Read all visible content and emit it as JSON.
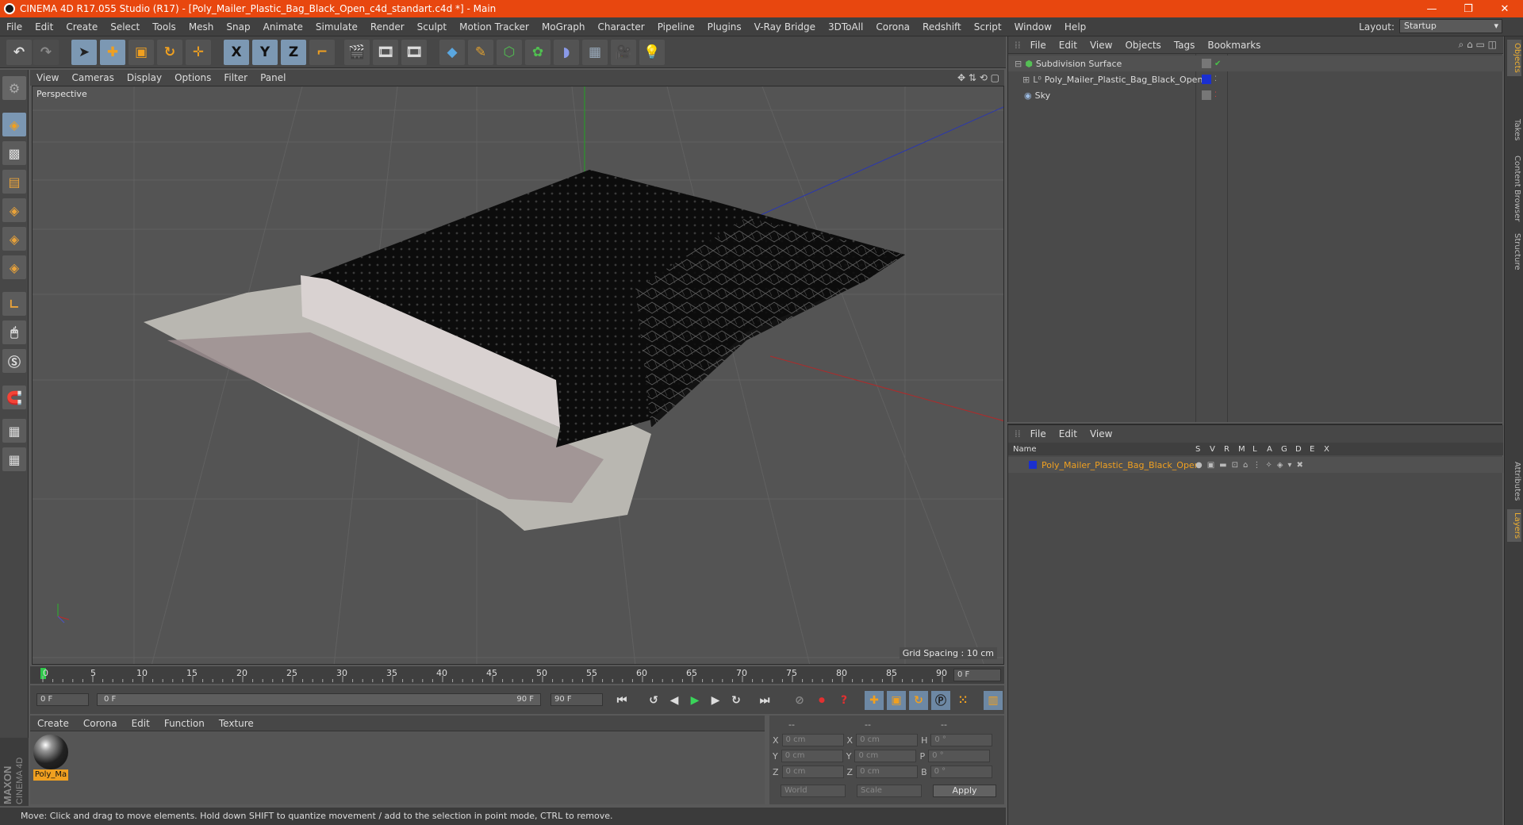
{
  "window": {
    "title": "CINEMA 4D R17.055 Studio (R17) - [Poly_Mailer_Plastic_Bag_Black_Open_c4d_standart.c4d *] - Main",
    "minimize": "—",
    "restore": "❐",
    "close": "✕"
  },
  "menu": [
    "File",
    "Edit",
    "Create",
    "Select",
    "Tools",
    "Mesh",
    "Snap",
    "Animate",
    "Simulate",
    "Render",
    "Sculpt",
    "Motion Tracker",
    "MoGraph",
    "Character",
    "Pipeline",
    "Plugins",
    "V-Ray Bridge",
    "3DToAll",
    "Corona",
    "Redshift",
    "Script",
    "Window",
    "Help"
  ],
  "layout": {
    "label": "Layout:",
    "value": "Startup"
  },
  "toolbar": {
    "x_axis": "X",
    "y_axis": "Y",
    "z_axis": "Z"
  },
  "viewport": {
    "menu": [
      "View",
      "Cameras",
      "Display",
      "Options",
      "Filter",
      "Panel"
    ],
    "name": "Perspective",
    "grid_spacing": "Grid Spacing : 10 cm"
  },
  "timeline": {
    "ticks": [
      "0",
      "5",
      "10",
      "15",
      "20",
      "25",
      "30",
      "35",
      "40",
      "45",
      "50",
      "55",
      "60",
      "65",
      "70",
      "75",
      "80",
      "85",
      "90"
    ],
    "current": "0 F",
    "start": "0 F",
    "range_start": "0 F",
    "range_end": "90 F",
    "end": "90 F"
  },
  "material_manager": {
    "menu": [
      "Create",
      "Corona",
      "Edit",
      "Function",
      "Texture"
    ],
    "materials": [
      {
        "label": "Poly_Ma"
      }
    ]
  },
  "coordinates": {
    "header": [
      "--",
      "--",
      "--"
    ],
    "rows": [
      {
        "a": "X",
        "av": "0 cm",
        "b": "X",
        "bv": "0 cm",
        "c": "H",
        "cv": "0 °"
      },
      {
        "a": "Y",
        "av": "0 cm",
        "b": "Y",
        "bv": "0 cm",
        "c": "P",
        "cv": "0 °"
      },
      {
        "a": "Z",
        "av": "0 cm",
        "b": "Z",
        "bv": "0 cm",
        "c": "B",
        "cv": "0 °"
      }
    ],
    "world": "World",
    "scale": "Scale",
    "apply": "Apply"
  },
  "status": "Move: Click and drag to move elements. Hold down SHIFT to quantize movement / add to the selection in point mode, CTRL to remove.",
  "object_manager": {
    "menu": [
      "File",
      "Edit",
      "View",
      "Objects",
      "Tags",
      "Bookmarks"
    ],
    "objects": [
      {
        "name": "Subdivision Surface"
      },
      {
        "name": "Poly_Mailer_Plastic_Bag_Black_Open"
      },
      {
        "name": "Sky"
      }
    ]
  },
  "layer_manager": {
    "menu": [
      "File",
      "Edit",
      "View"
    ],
    "columns": [
      "Name",
      "S",
      "V",
      "R",
      "M",
      "L",
      "A",
      "G",
      "D",
      "E",
      "X"
    ],
    "layers": [
      {
        "name": "Poly_Mailer_Plastic_Bag_Black_Open",
        "color": "#1a2fd0"
      }
    ]
  },
  "side_tabs": [
    "Objects",
    "Takes",
    "Content Browser",
    "Structure",
    "Attributes",
    "Layers"
  ],
  "brand": {
    "line1": "MAXON",
    "line2": "CINEMA 4D"
  },
  "colors": {
    "title_bar": "#e8470f",
    "accent_orange": "#f0a020",
    "active_blue": "#7c98b3"
  }
}
